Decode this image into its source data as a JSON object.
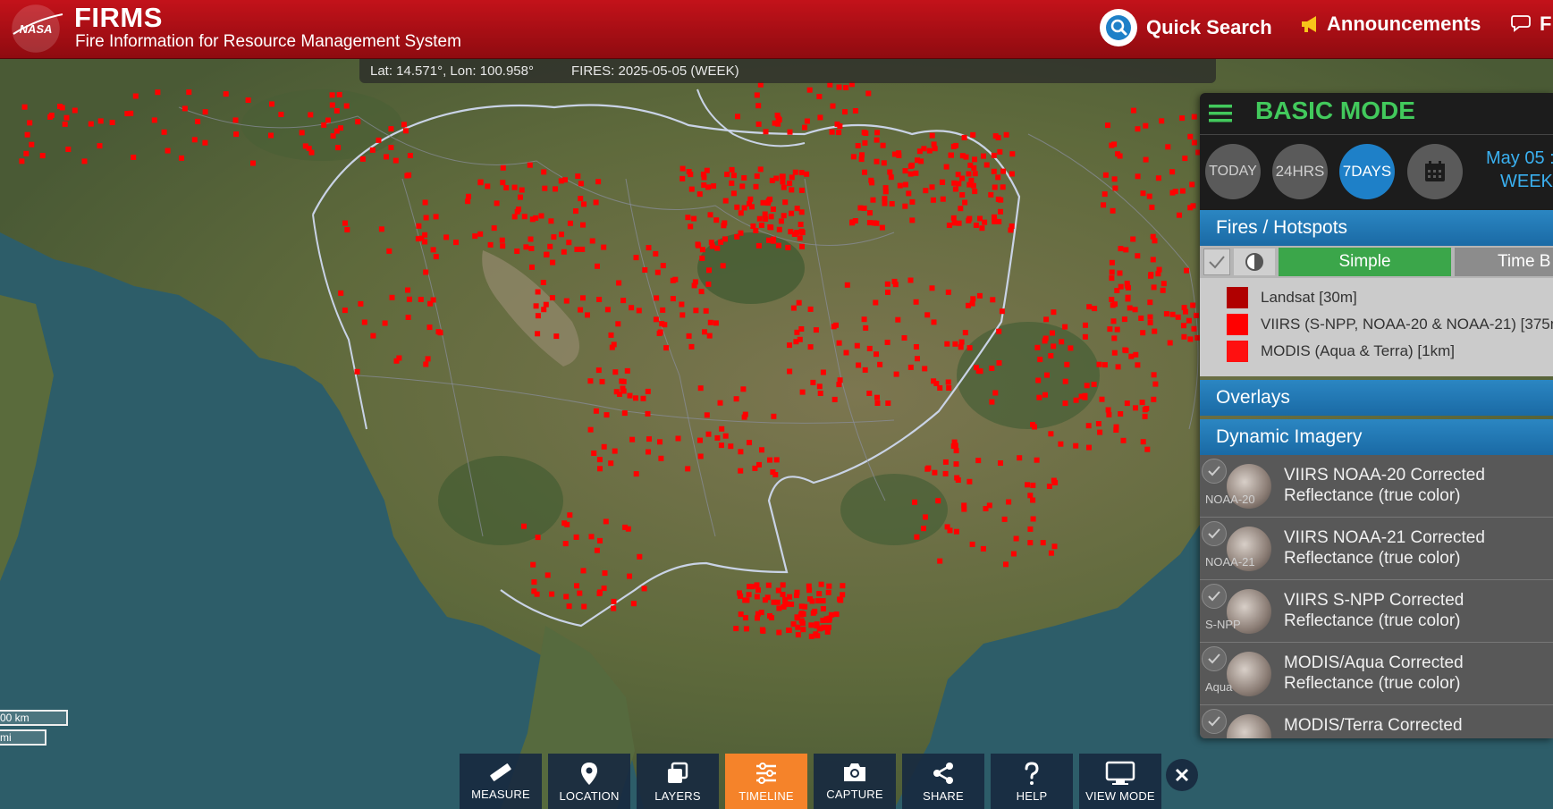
{
  "header": {
    "logo_text": "NASA",
    "title": "FIRMS",
    "subtitle": "Fire Information for Resource Management System",
    "quick_search": "Quick Search",
    "announcements": "Announcements",
    "feedback": "F"
  },
  "info_bar": {
    "coords": "Lat: 14.571°, Lon: 100.958°",
    "fires": "FIRES: 2025-05-05 (WEEK)"
  },
  "panel": {
    "mode_title": "BASIC MODE",
    "time_buttons": {
      "today": "TODAY",
      "hrs24": "24HRS",
      "days7": "7DAYS"
    },
    "selected_range": "7DAYS",
    "date_line1": "May 05 :",
    "date_line2": "WEEK",
    "fires_header": "Fires / Hotspots",
    "toolbar": {
      "simple": "Simple",
      "time_b": "Time B"
    },
    "legend": [
      {
        "label": "Landsat [30m]",
        "color": "#b00000"
      },
      {
        "label": "VIIRS (S-NPP, NOAA-20 & NOAA-21) [375m",
        "color": "#ff0000"
      },
      {
        "label": "MODIS (Aqua & Terra) [1km]",
        "color": "#ff1010"
      }
    ],
    "overlays_header": "Overlays",
    "imagery_header": "Dynamic Imagery",
    "imagery": [
      {
        "short": "NOAA-20",
        "title1": "VIIRS NOAA-20 Corrected",
        "title2": "Reflectance (true color)"
      },
      {
        "short": "NOAA-21",
        "title1": "VIIRS NOAA-21 Corrected",
        "title2": "Reflectance (true color)"
      },
      {
        "short": "S-NPP",
        "title1": "VIIRS S-NPP Corrected",
        "title2": "Reflectance (true color)"
      },
      {
        "short": "Aqua",
        "title1": "MODIS/Aqua Corrected",
        "title2": "Reflectance (true color)"
      },
      {
        "short": "",
        "title1": "MODIS/Terra Corrected",
        "title2": ""
      }
    ]
  },
  "scale": {
    "km": "00 km",
    "mi": "mi"
  },
  "toolbar": {
    "measure": "MEASURE",
    "location": "LOCATION",
    "layers": "LAYERS",
    "timeline": "TIMELINE",
    "capture": "CAPTURE",
    "share": "SHARE",
    "help": "HELP",
    "view_mode": "VIEW MODE",
    "active": "TIMELINE"
  },
  "colors": {
    "header_red": "#b10f16",
    "accent_green": "#42c95c",
    "accent_blue": "#1e80c8",
    "active_orange": "#f5832a",
    "fire_red": "#ff0000"
  }
}
